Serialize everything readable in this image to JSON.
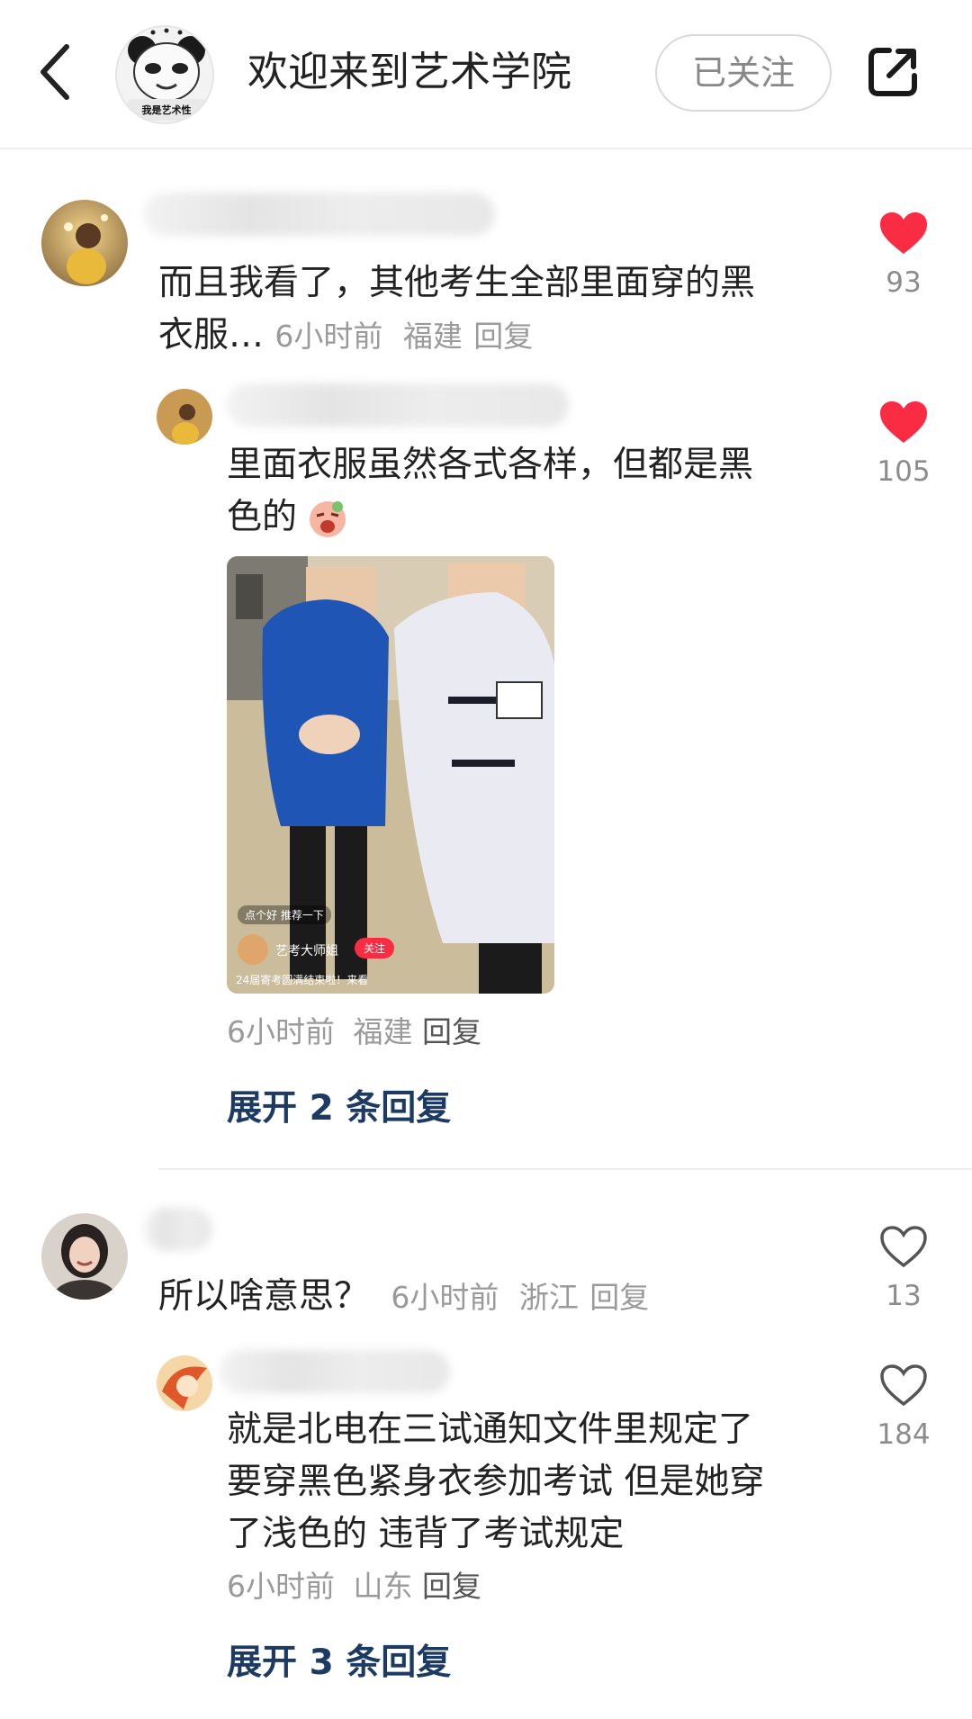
{
  "header": {
    "title": "欢迎来到艺术学院",
    "avatar_caption": "我是艺术性",
    "follow_label": "已关注"
  },
  "comments": [
    {
      "text": "而且我看了，其他考生全部里面穿的黑衣服…",
      "line1": "而且我看了，其他考生全部里面穿的黑",
      "line2": "衣服…",
      "time": "6小时前",
      "location": "福建",
      "reply": "回复",
      "likes": "93",
      "liked": true,
      "sub": {
        "line1": "里面衣服虽然各式各样，但都是黑",
        "line2": "色的",
        "time": "6小时前",
        "location": "福建",
        "reply": "回复",
        "likes": "105",
        "liked": true,
        "image": {
          "overlay_top": "点个好 推荐一下",
          "author": "艺考大师姐",
          "follow": "关注",
          "caption": "24届寄考圆满结束啦！来看"
        }
      },
      "expand": "展开 2 条回复"
    },
    {
      "text": "所以啥意思？",
      "time": "6小时前",
      "location": "浙江",
      "reply": "回复",
      "likes": "13",
      "liked": false,
      "sub": {
        "line1": "就是北电在三试通知文件里规定了",
        "line2": "要穿黑色紧身衣参加考试 但是她穿",
        "line3": "了浅色的 违背了考试规定",
        "time": "6小时前",
        "location": "山东",
        "reply": "回复",
        "likes": "184",
        "liked": false
      },
      "expand": "展开 3 条回复"
    }
  ],
  "colors": {
    "like_red": "#fa2c44",
    "expand_blue": "#1d3a63",
    "meta_gray": "#9a9a9a"
  }
}
